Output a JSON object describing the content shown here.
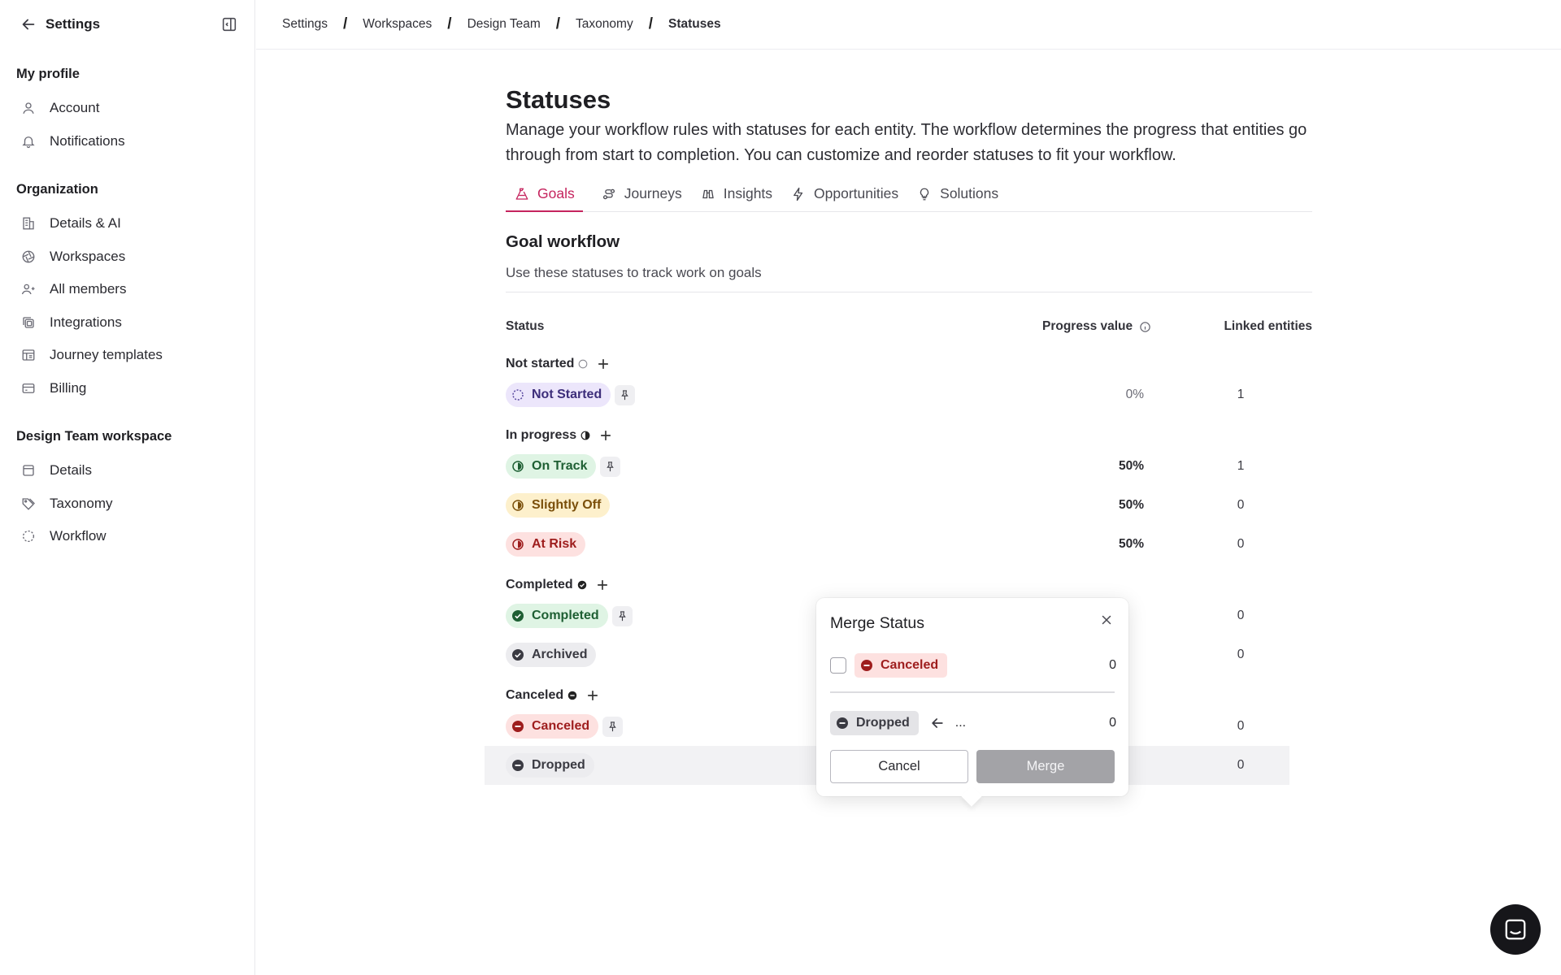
{
  "sidebar": {
    "title": "Settings",
    "sections": [
      {
        "title": "My profile",
        "items": [
          {
            "label": "Account",
            "icon": "user-icon"
          },
          {
            "label": "Notifications",
            "icon": "bell-icon"
          }
        ]
      },
      {
        "title": "Organization",
        "items": [
          {
            "label": "Details & AI",
            "icon": "building-icon"
          },
          {
            "label": "Workspaces",
            "icon": "aperture-icon"
          },
          {
            "label": "All members",
            "icon": "users-icon"
          },
          {
            "label": "Integrations",
            "icon": "integrations-icon"
          },
          {
            "label": "Journey templates",
            "icon": "template-icon"
          },
          {
            "label": "Billing",
            "icon": "card-icon"
          }
        ]
      },
      {
        "title": "Design Team workspace",
        "items": [
          {
            "label": "Details",
            "icon": "window-icon"
          },
          {
            "label": "Taxonomy",
            "icon": "tag-icon"
          },
          {
            "label": "Workflow",
            "icon": "dashed-circle-icon"
          }
        ]
      }
    ]
  },
  "breadcrumb": [
    "Settings",
    "Workspaces",
    "Design Team",
    "Taxonomy",
    "Statuses"
  ],
  "page": {
    "title": "Statuses",
    "description": "Manage your workflow rules with statuses for each entity. The workflow determines the progress that entities go through from start to completion. You can customize and reorder statuses to fit your workflow."
  },
  "tabs": [
    {
      "label": "Goals",
      "icon": "goal-icon",
      "active": true
    },
    {
      "label": "Journeys",
      "icon": "journey-icon"
    },
    {
      "label": "Insights",
      "icon": "binoculars-icon"
    },
    {
      "label": "Opportunities",
      "icon": "lightning-icon"
    },
    {
      "label": "Solutions",
      "icon": "lightbulb-icon"
    }
  ],
  "workflow": {
    "title": "Goal workflow",
    "subtitle": "Use these statuses to track work on goals",
    "columns": {
      "status": "Status",
      "progress": "Progress value",
      "linked": "Linked entities"
    },
    "groups": [
      {
        "name": "Not started",
        "statuses": [
          {
            "label": "Not Started",
            "progress": "0%",
            "linked": "1",
            "pinned": true
          }
        ]
      },
      {
        "name": "In progress",
        "statuses": [
          {
            "label": "On Track",
            "progress": "50%",
            "linked": "1",
            "pinned": true
          },
          {
            "label": "Slightly Off",
            "progress": "50%",
            "linked": "0"
          },
          {
            "label": "At Risk",
            "progress": "50%",
            "linked": "0"
          }
        ]
      },
      {
        "name": "Completed",
        "statuses": [
          {
            "label": "Completed",
            "progress": "",
            "linked": "0",
            "pinned": true
          },
          {
            "label": "Archived",
            "progress": "",
            "linked": "0"
          }
        ]
      },
      {
        "name": "Canceled",
        "statuses": [
          {
            "label": "Canceled",
            "progress": "",
            "linked": "0",
            "pinned": true
          },
          {
            "label": "Dropped",
            "progress": "",
            "linked": "0"
          }
        ]
      }
    ]
  },
  "merge_popover": {
    "title": "Merge Status",
    "target_label": "Canceled",
    "target_count": "0",
    "source_label": "Dropped",
    "source_count": "0",
    "ellipsis": "...",
    "cancel_label": "Cancel",
    "merge_label": "Merge"
  },
  "colors": {
    "accent": "#c5245e",
    "not_started": "#ece6fb",
    "on_track": "#dff4e4",
    "slightly_off": "#fdf0cc",
    "at_risk": "#fde1e0",
    "neutral": "#ececef"
  }
}
